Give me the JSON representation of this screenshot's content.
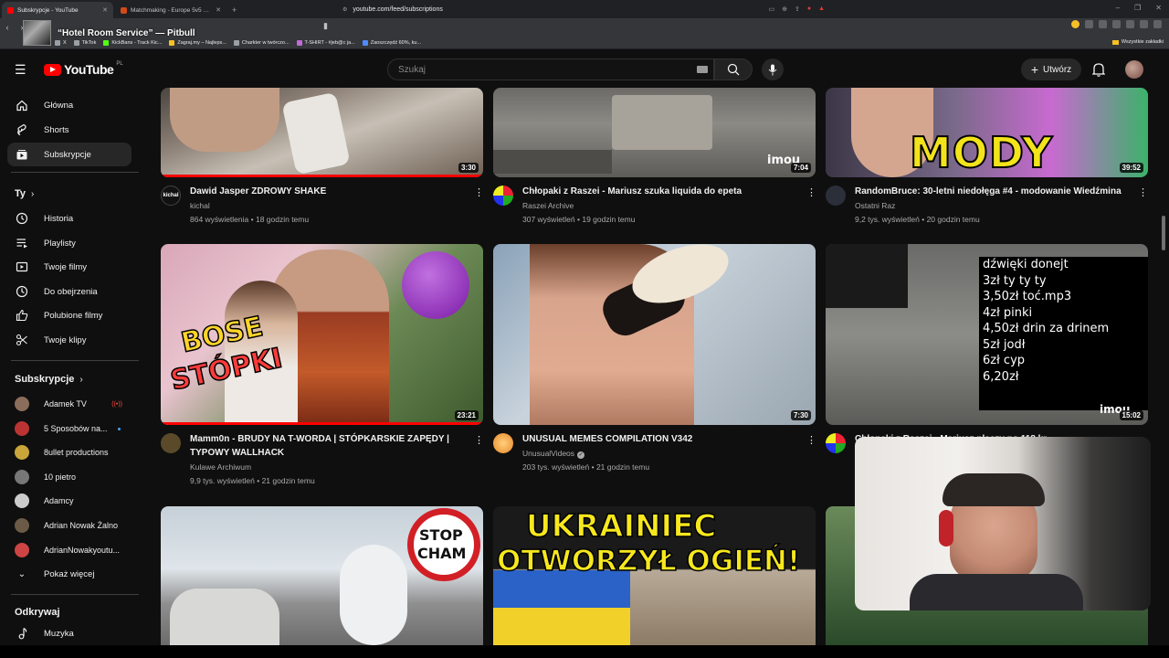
{
  "browser": {
    "tabs": [
      {
        "title": "Subskrypcje - YouTube",
        "active": true
      },
      {
        "title": "Matchmaking - Europe 5v5 Queue - ...",
        "active": false
      }
    ],
    "url": "youtube.com/feed/subscriptions",
    "bookmarks": [
      "X",
      "TikTok",
      "KickBans - Track Kic...",
      "Zagraj.my – Najleps...",
      "Charkter w twórczo...",
      "T-SHIRT - #jeb@c ja...",
      "Zaoszczędź 60%, ku..."
    ],
    "all_bookmarks": "Wszystkie zakładki"
  },
  "now_playing": "“Hotel Room Service” — Pitbull",
  "youtube": {
    "logo_text": "YouTube",
    "logo_region": "PL",
    "search_placeholder": "Szukaj",
    "create_label": "Utwórz"
  },
  "sidebar": {
    "main": [
      {
        "label": "Główna",
        "icon": "home-icon"
      },
      {
        "label": "Shorts",
        "icon": "shorts-icon"
      },
      {
        "label": "Subskrypcje",
        "icon": "subscriptions-icon",
        "active": true
      }
    ],
    "you_header": "Ty",
    "you": [
      {
        "label": "Historia",
        "icon": "history-icon"
      },
      {
        "label": "Playlisty",
        "icon": "playlists-icon"
      },
      {
        "label": "Twoje filmy",
        "icon": "your-videos-icon"
      },
      {
        "label": "Do obejrzenia",
        "icon": "watch-later-icon"
      },
      {
        "label": "Polubione filmy",
        "icon": "liked-icon"
      },
      {
        "label": "Twoje klipy",
        "icon": "clips-icon"
      }
    ],
    "subs_header": "Subskrypcje",
    "subs": [
      {
        "label": "Adamek TV",
        "badge": "live",
        "color": "#8a6d5a"
      },
      {
        "label": "5 Sposobów na...",
        "badge": "dot",
        "color": "#b33"
      },
      {
        "label": "8ullet productions",
        "color": "#c9a53a"
      },
      {
        "label": "10 pietro",
        "color": "#777"
      },
      {
        "label": "Adamcy",
        "color": "#ccc"
      },
      {
        "label": "Adrian Nowak Żalno",
        "color": "#6b5a45"
      },
      {
        "label": "AdrianNowakyoutu...",
        "color": "#c44"
      }
    ],
    "show_more": "Pokaż więcej",
    "explore_header": "Odkrywaj",
    "explore": [
      {
        "label": "Muzyka",
        "icon": "music-icon"
      }
    ]
  },
  "videos": [
    {
      "title": "Dawid Jasper ZDROWY SHAKE",
      "channel": "kichal",
      "views": "864 wyświetlenia",
      "age": "18 godzin temu",
      "duration": "3:30"
    },
    {
      "title": "Chłopaki z Raszei - Mariusz szuka liquida do epeta",
      "channel": "Raszei Archive",
      "views": "307 wyświetleń",
      "age": "19 godzin temu",
      "duration": "7:04"
    },
    {
      "title": "RandomBruce: 30-letni niedołęga #4 - modowanie Wiedźmina",
      "channel": "Ostatni Raz",
      "views": "9,2 tys. wyświetleń",
      "age": "20 godzin temu",
      "duration": "39:52"
    },
    {
      "title": "Mamm0n - BRUDY NA T-WORDA | STÓPKARSKIE ZAPĘDY | TYPOWY WALLHACK",
      "channel": "Kulawe Archiwum",
      "views": "9,9 tys. wyświetleń",
      "age": "21 godzin temu",
      "duration": "23:21"
    },
    {
      "title": "UNUSUAL MEMES COMPILATION V342",
      "channel": "UnusualVideos",
      "views": "203 tys. wyświetleń",
      "age": "21 godzin temu",
      "duration": "7:30"
    },
    {
      "title": "Chłopaki z Raszei - Mariusz płaczy po 118 kr...",
      "channel": "",
      "views": "",
      "age": "",
      "duration": "15:02"
    }
  ],
  "thumb_text": {
    "mody": "MODY",
    "bose": "BOSE",
    "stopki": "STÓPKI",
    "stop": "STOP",
    "cham": "CHAM",
    "ukrainiec": "UKRAINIEC",
    "otworzyl": "OTWORZYŁ OGIEŃ!",
    "imou": "imou",
    "donate_lines": [
      "dźwięki donejt",
      "3zł ty ty ty",
      "3,50zł toć.mp3",
      "4zł pinki",
      "4,50zł drin za drinem",
      "5zł jodł",
      "6zł cyp",
      "6,20zł"
    ]
  }
}
